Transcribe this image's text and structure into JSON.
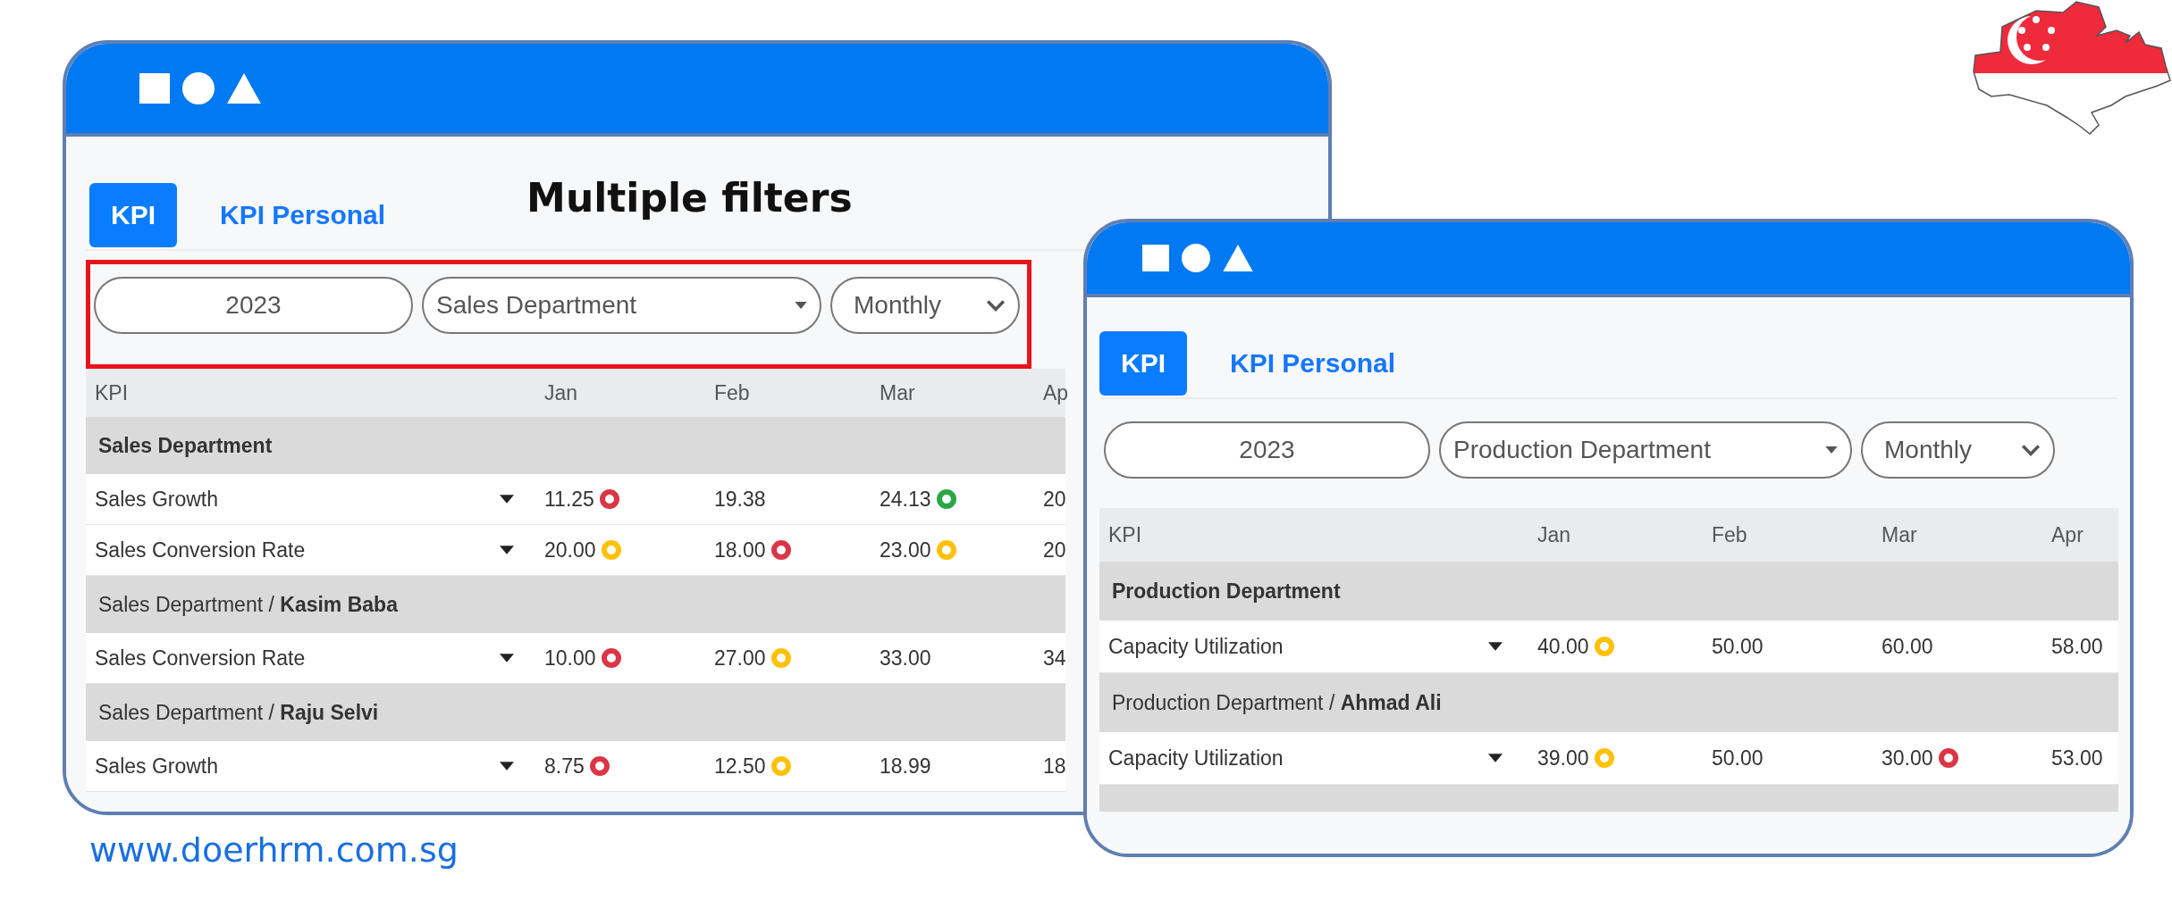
{
  "windows": [
    {
      "title": "Multiple filters",
      "tabs": [
        {
          "label": "KPI",
          "selected": true
        },
        {
          "label": "KPI Personal",
          "selected": false
        }
      ],
      "filters": {
        "highlighted": true,
        "year": "2023",
        "department": "Sales Department",
        "period": "Monthly"
      },
      "columns": [
        "KPI",
        "Jan",
        "Feb",
        "Mar",
        "Ap"
      ],
      "rows": [
        {
          "kind": "department",
          "label": "Sales Department"
        },
        {
          "kind": "kpi",
          "label": "Sales Growth",
          "cells": [
            {
              "value": "11.25",
              "color": "#dc3545"
            },
            {
              "value": "19.38"
            },
            {
              "value": "24.13",
              "color": "#28a745"
            },
            {
              "value": "20"
            }
          ]
        },
        {
          "kind": "kpi",
          "label": "Sales Conversion Rate",
          "cells": [
            {
              "value": "20.00",
              "color": "#ffc107"
            },
            {
              "value": "18.00",
              "color": "#dc3545"
            },
            {
              "value": "23.00",
              "color": "#ffc107"
            },
            {
              "value": "20"
            }
          ]
        },
        {
          "kind": "person",
          "label": "Sales Department / **Kasim Baba**"
        },
        {
          "kind": "kpi",
          "label": "Sales Conversion Rate",
          "cells": [
            {
              "value": "10.00",
              "color": "#dc3545"
            },
            {
              "value": "27.00",
              "color": "#ffc107"
            },
            {
              "value": "33.00"
            },
            {
              "value": "34"
            }
          ]
        },
        {
          "kind": "person",
          "label": "Sales Department / **Raju Selvi**"
        },
        {
          "kind": "kpi",
          "label": "Sales Growth",
          "cells": [
            {
              "value": "8.75",
              "color": "#dc3545"
            },
            {
              "value": "12.50",
              "color": "#ffc107"
            },
            {
              "value": "18.99"
            },
            {
              "value": "18"
            }
          ]
        }
      ]
    },
    {
      "tabs": [
        {
          "label": "KPI",
          "selected": true
        },
        {
          "label": "KPI Personal",
          "selected": false
        }
      ],
      "filters": {
        "highlighted": false,
        "year": "2023",
        "department": "Production Department",
        "period": "Monthly"
      },
      "columns": [
        "KPI",
        "Jan",
        "Feb",
        "Mar",
        "Apr"
      ],
      "rows": [
        {
          "kind": "department",
          "label": "Production Department"
        },
        {
          "kind": "kpi",
          "label": "Capacity Utilization",
          "cells": [
            {
              "value": "40.00",
              "color": "#ffc107"
            },
            {
              "value": "50.00"
            },
            {
              "value": "60.00"
            },
            {
              "value": "58.00"
            }
          ]
        },
        {
          "kind": "person",
          "label": "Production Department / **Ahmad Ali**"
        },
        {
          "kind": "kpi",
          "label": "Capacity Utilization",
          "cells": [
            {
              "value": "39.00",
              "color": "#ffc107"
            },
            {
              "value": "50.00"
            },
            {
              "value": "30.00",
              "color": "#dc3545"
            },
            {
              "value": "53.00"
            }
          ]
        },
        {
          "kind": "blank"
        }
      ]
    }
  ],
  "website": "www.doerhrm.com.sg"
}
